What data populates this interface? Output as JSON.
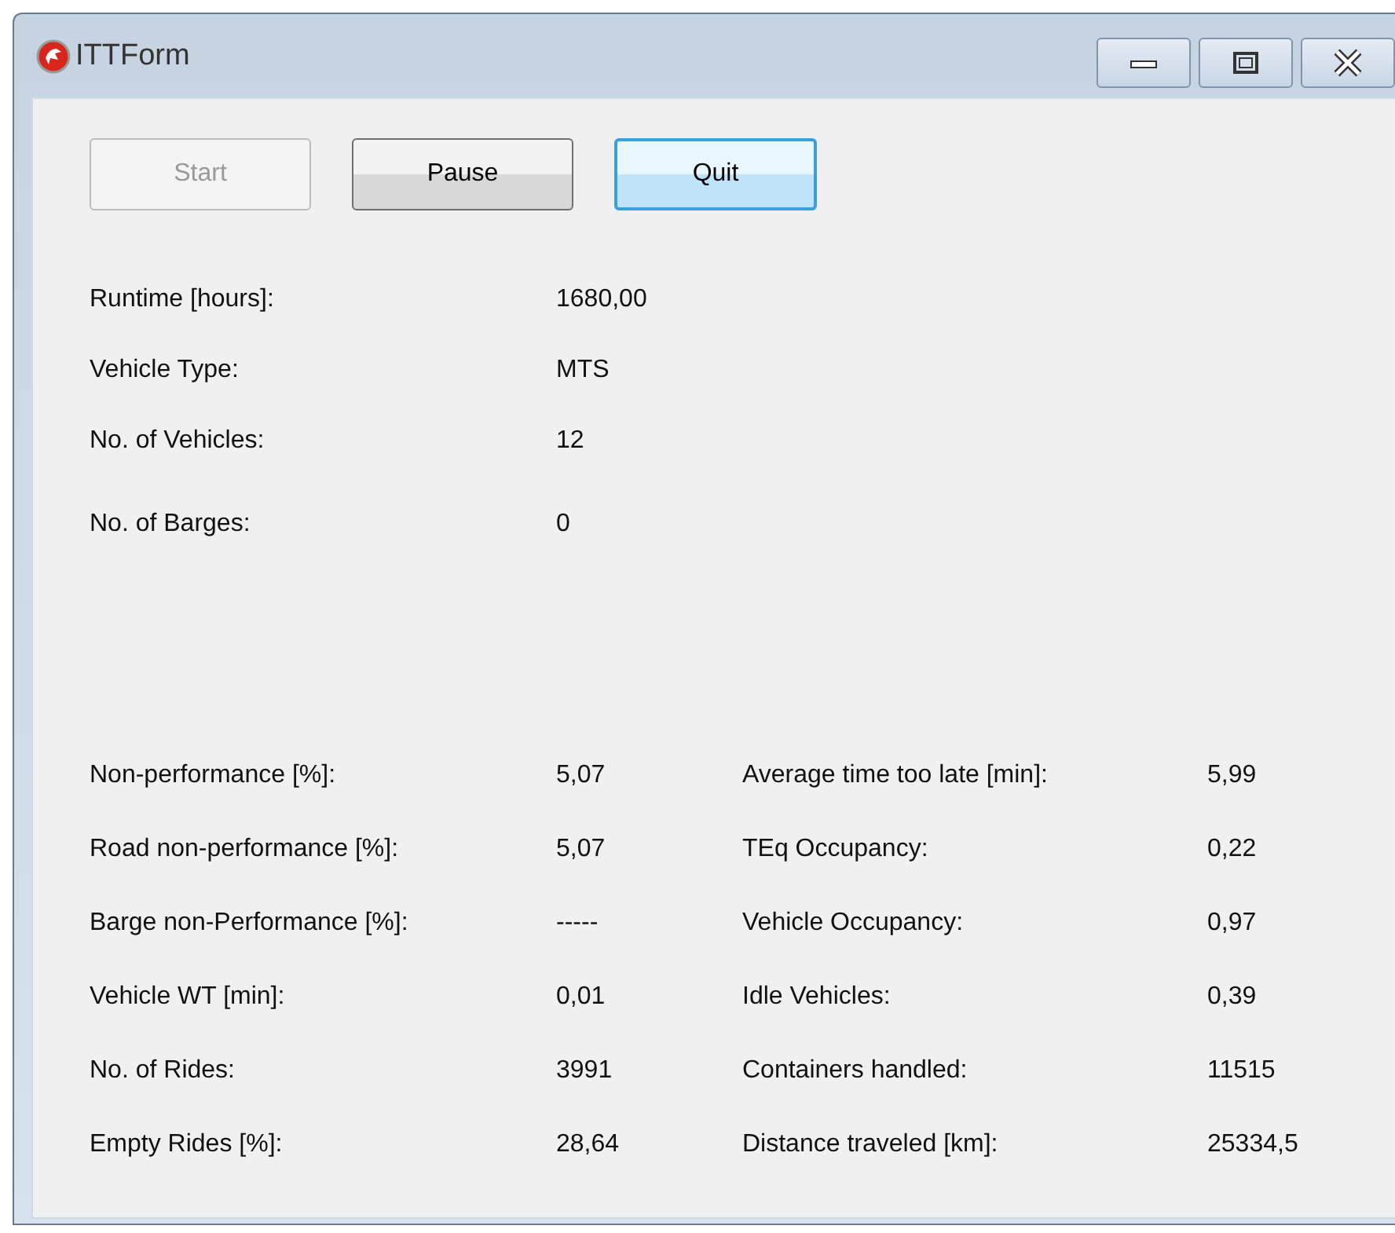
{
  "window": {
    "title": "ITTForm"
  },
  "buttons": [
    {
      "label": "Start",
      "disabled": true,
      "focused": false
    },
    {
      "label": "Pause",
      "disabled": false,
      "focused": false
    },
    {
      "label": "Quit",
      "disabled": false,
      "focused": true
    }
  ],
  "settings": [
    {
      "label": "Runtime [hours]:",
      "value": "1680,00"
    },
    {
      "label": "Vehicle Type:",
      "value": "MTS"
    },
    {
      "label": "No. of Vehicles:",
      "value": "12"
    },
    {
      "label": "No. of Barges:",
      "value": "0"
    }
  ],
  "results_left": [
    {
      "label": "Non-performance [%]:",
      "value": "5,07"
    },
    {
      "label": "Road non-performance [%]:",
      "value": "5,07"
    },
    {
      "label": "Barge non-Performance [%]:",
      "value": "-----"
    },
    {
      "label": "Vehicle WT [min]:",
      "value": "0,01"
    },
    {
      "label": "No. of Rides:",
      "value": "3991"
    },
    {
      "label": "Empty Rides [%]:",
      "value": "28,64"
    }
  ],
  "results_right": [
    {
      "label": "Average time too late [min]:",
      "value": "5,99"
    },
    {
      "label": "TEq Occupancy:",
      "value": "0,22"
    },
    {
      "label": "Vehicle Occupancy:",
      "value": "0,97"
    },
    {
      "label": "Idle Vehicles:",
      "value": "0,39"
    },
    {
      "label": "Containers handled:",
      "value": "11515"
    },
    {
      "label": "Distance traveled [km]:",
      "value": "25334,5"
    }
  ]
}
